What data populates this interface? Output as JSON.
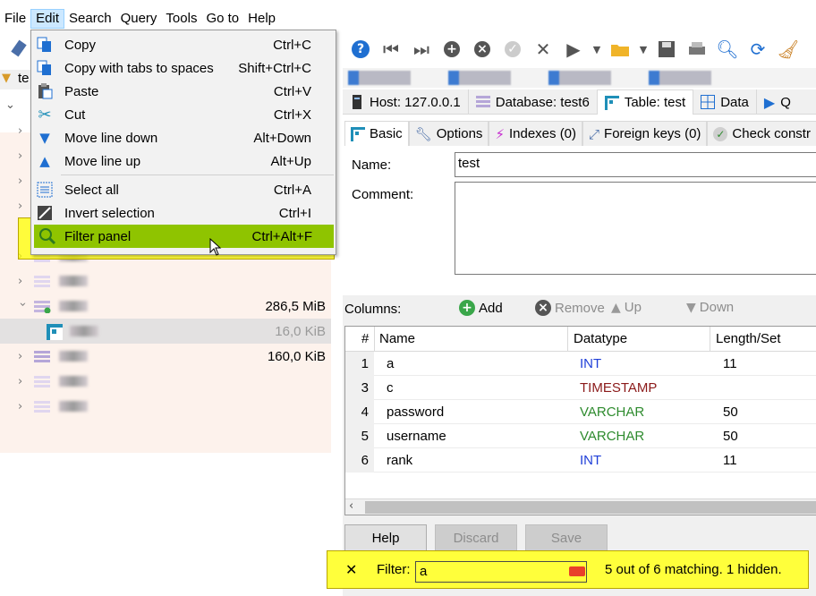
{
  "menubar": {
    "items": [
      "File",
      "Edit",
      "Search",
      "Query",
      "Tools",
      "Go to",
      "Help"
    ]
  },
  "edit_menu": {
    "items": [
      {
        "label": "Copy",
        "shortcut": "Ctrl+C",
        "icon": "copy-icon"
      },
      {
        "label": "Copy with tabs to spaces",
        "shortcut": "Shift+Ctrl+C",
        "icon": "copy-tabs-icon"
      },
      {
        "label": "Paste",
        "shortcut": "Ctrl+V",
        "icon": "paste-icon"
      },
      {
        "label": "Cut",
        "shortcut": "Ctrl+X",
        "icon": "cut-icon"
      },
      {
        "label": "Move line down",
        "shortcut": "Alt+Down",
        "icon": "arrow-down-icon"
      },
      {
        "label": "Move line up",
        "shortcut": "Alt+Up",
        "icon": "arrow-up-icon"
      },
      {
        "label": "Select all",
        "shortcut": "Ctrl+A",
        "icon": "select-all-icon"
      },
      {
        "label": "Invert selection",
        "shortcut": "Ctrl+I",
        "icon": "invert-selection-icon"
      },
      {
        "label": "Filter panel",
        "shortcut": "Ctrl+Alt+F",
        "icon": "magnifier-icon"
      }
    ]
  },
  "tree": {
    "sizes": [
      "286,5 MiB",
      "16,0 KiB",
      "160,0 KiB"
    ]
  },
  "host_tabs": {
    "host": "Host: 127.0.0.1",
    "database": "Database: test6",
    "table": "Table: test",
    "data": "Data",
    "query": "Q"
  },
  "editor_tabs": {
    "basic": "Basic",
    "options": "Options",
    "indexes": "Indexes (0)",
    "foreign_keys": "Foreign keys (0)",
    "check": "Check constr"
  },
  "form": {
    "name_label": "Name:",
    "name_value": "test",
    "comment_label": "Comment:"
  },
  "columns_bar": {
    "label": "Columns:",
    "add": "Add",
    "remove": "Remove",
    "up": "Up",
    "down": "Down"
  },
  "grid": {
    "headers": [
      "#",
      "Name",
      "Datatype",
      "Length/Set"
    ],
    "rows": [
      {
        "num": "1",
        "name": "a",
        "type": "INT",
        "length": "11",
        "type_color": "#1f3fd8"
      },
      {
        "num": "3",
        "name": "c",
        "type": "TIMESTAMP",
        "length": "",
        "type_color": "#8b1a1a"
      },
      {
        "num": "4",
        "name": "password",
        "type": "VARCHAR",
        "length": "50",
        "type_color": "#2e8b2e"
      },
      {
        "num": "5",
        "name": "username",
        "type": "VARCHAR",
        "length": "50",
        "type_color": "#2e8b2e"
      },
      {
        "num": "6",
        "name": "rank",
        "type": "INT",
        "length": "11",
        "type_color": "#1f3fd8"
      }
    ]
  },
  "buttons": {
    "help": "Help",
    "discard": "Discard",
    "save": "Save"
  },
  "filter": {
    "label": "Filter:",
    "value": "a",
    "status": "5 out of 6 matching. 1 hidden."
  },
  "tree_partial_label": "te"
}
